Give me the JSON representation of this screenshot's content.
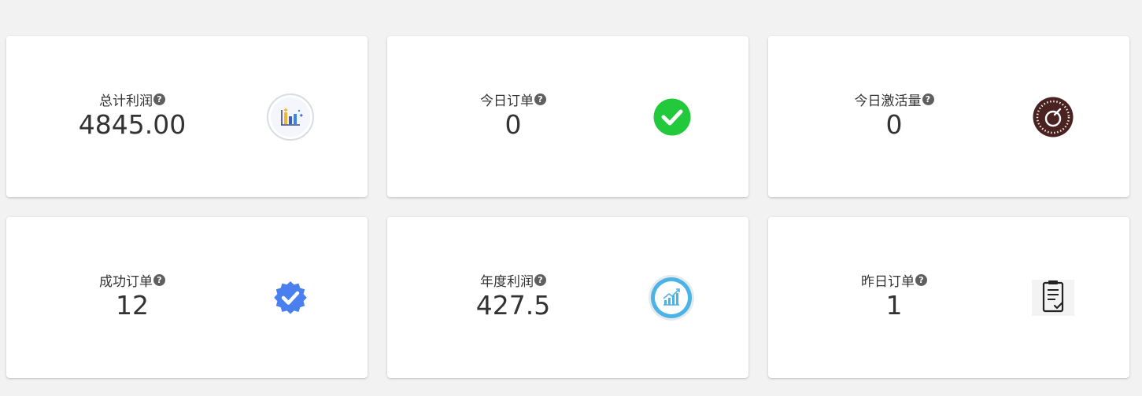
{
  "cards": [
    {
      "label": "总计利润",
      "value": "4845.00",
      "icon": "bar-chart-icon"
    },
    {
      "label": "今日订单",
      "value": "0",
      "icon": "check-circle-icon"
    },
    {
      "label": "今日激活量",
      "value": "0",
      "icon": "power-gauge-icon"
    },
    {
      "label": "成功订单",
      "value": "12",
      "icon": "verified-badge-icon"
    },
    {
      "label": "年度利润",
      "value": "427.5",
      "icon": "growth-chart-icon"
    },
    {
      "label": "昨日订单",
      "value": "1",
      "icon": "clipboard-check-icon"
    }
  ],
  "help_symbol": "?",
  "colors": {
    "page_background": "#f2f2f2",
    "card_background": "#ffffff",
    "text": "#333333",
    "help_icon": "#5f5f5f",
    "check_green": "#22c93a",
    "gauge_brown": "#4a2320",
    "badge_blue": "#4a7ff0",
    "growth_blue": "#4bb3e6"
  }
}
